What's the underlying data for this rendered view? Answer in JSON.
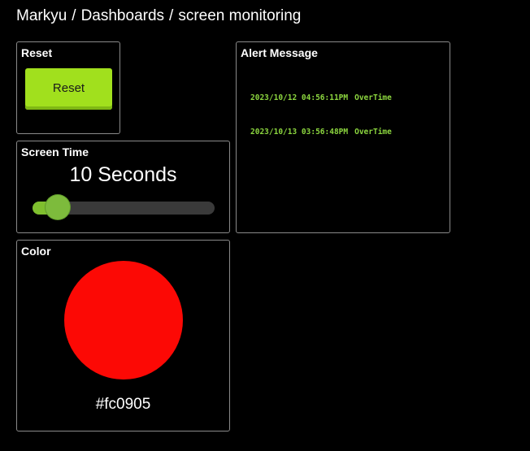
{
  "breadcrumb": {
    "app": "Markyu",
    "section": "Dashboards",
    "page": "screen monitoring",
    "separator": "/"
  },
  "reset_card": {
    "title": "Reset",
    "button_label": "Reset",
    "button_color": "#a1e01d"
  },
  "screen_time_card": {
    "title": "Screen Time",
    "value_text": "10 Seconds",
    "slider_level": 0.08,
    "slider_color": "#7dbb3c"
  },
  "color_card": {
    "title": "Color",
    "color_hex": "#fc0905"
  },
  "alert_card": {
    "title": "Alert Message",
    "text_color": "#8cd63f",
    "messages": [
      {
        "time": "2023/10/12 04:56:11PM",
        "text": "OverTime"
      },
      {
        "time": "2023/10/13 03:56:48PM",
        "text": "OverTime"
      }
    ]
  }
}
